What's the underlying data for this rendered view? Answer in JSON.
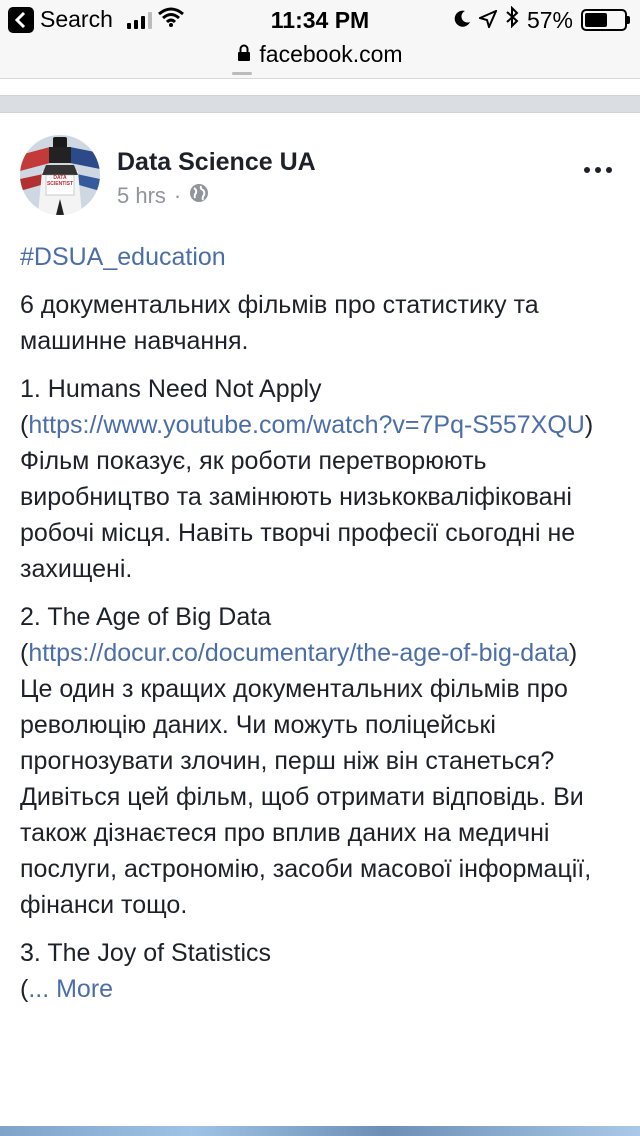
{
  "status_bar": {
    "back_label": "Search",
    "time": "11:34 PM",
    "battery": "57%",
    "battery_level": 0.57
  },
  "url_bar": {
    "domain": "facebook.com"
  },
  "post": {
    "author": "Data Science UA",
    "time_ago": "5 hrs",
    "meta_sep": "·",
    "avatar_text": "DATA SCIENTIST",
    "hashtag": "#DSUA_education",
    "intro": "6 документальних фільмів про статистику та машинне навчання.",
    "items": [
      {
        "title": "1. Humans Need Not Apply",
        "open_paren": "(",
        "link": "https://www.youtube.com/watch?v=7Pq-S557XQU",
        "close_paren": ")",
        "description": "Фільм показує, як роботи перетворюють виробництво та замінюють низькокваліфіковані робочі місця. Навіть творчі професії сьогодні не захищені."
      },
      {
        "title": "2. The Age of Big Data",
        "open_paren": "(",
        "link": "https://docur.co/documentary/the-age-of-big-data",
        "close_paren": ")",
        "description": "Це один з кращих документальних фільмів про революцію даних. Чи можуть поліцейські прогнозувати злочин, перш ніж він станеться? Дивіться цей фільм, щоб отримати відповідь. Ви також дізнаєтеся про вплив даних на медичні послуги, астрономію, засоби масової інформації, фінанси тощо."
      },
      {
        "title": "3. The Joy of Statistics",
        "open_paren": "(",
        "more_label": "... More"
      }
    ]
  },
  "colors": {
    "link": "#4b6ea9",
    "text": "#1d2129",
    "meta": "#90949c",
    "separator": "#dadde1"
  }
}
